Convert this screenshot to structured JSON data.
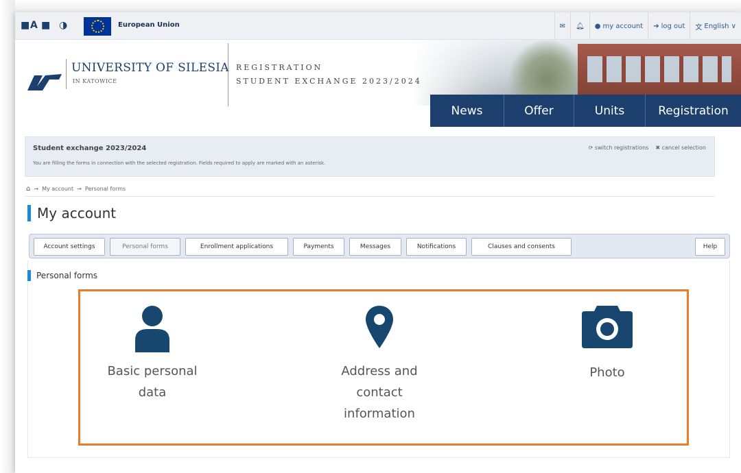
{
  "topbar": {
    "accessibility": [
      "■",
      "A",
      "■",
      "◑"
    ],
    "eu_label": "European Union",
    "links": [
      {
        "icon": "envelope-icon",
        "label": ""
      },
      {
        "icon": "bell-icon",
        "label": ""
      },
      {
        "icon": "user-icon",
        "label": "my account"
      },
      {
        "icon": "logout-icon",
        "label": "log out"
      },
      {
        "icon": "language-icon",
        "label": "English ∨"
      }
    ]
  },
  "header": {
    "university_name": "UNIVERSITY OF SILESIA",
    "university_sub": "IN KATOWICE",
    "registration_line1": "REGISTRATION",
    "registration_line2": "STUDENT EXCHANGE 2023/2024"
  },
  "nav": [
    "News",
    "Offer",
    "Units",
    "Registration"
  ],
  "info": {
    "title": "Student exchange 2023/2024",
    "text": "You are filling the forms in connection with the selected registration. Fields required to apply are marked with an asterisk.",
    "switch_label": "switch registrations",
    "cancel_label": "cancel selection"
  },
  "breadcrumb": [
    "My account",
    "Personal forms"
  ],
  "page_title": "My account",
  "tabs": [
    "Account settings",
    "Personal forms",
    "Enrollment applications",
    "Payments",
    "Messages",
    "Notifications",
    "Clauses and consents",
    "Help"
  ],
  "active_tab": "Personal forms",
  "section_title": "Personal forms",
  "cards": [
    {
      "icon": "person-icon",
      "label": "Basic personal data"
    },
    {
      "icon": "map-pin-icon",
      "label": "Address and contact information"
    },
    {
      "icon": "camera-icon",
      "label": "Photo"
    }
  ],
  "colors": {
    "navy": "#1d3f6e",
    "accent_blue": "#1a8ad4",
    "highlight_orange": "#ee7b2a",
    "icon_blue": "#17476f"
  }
}
